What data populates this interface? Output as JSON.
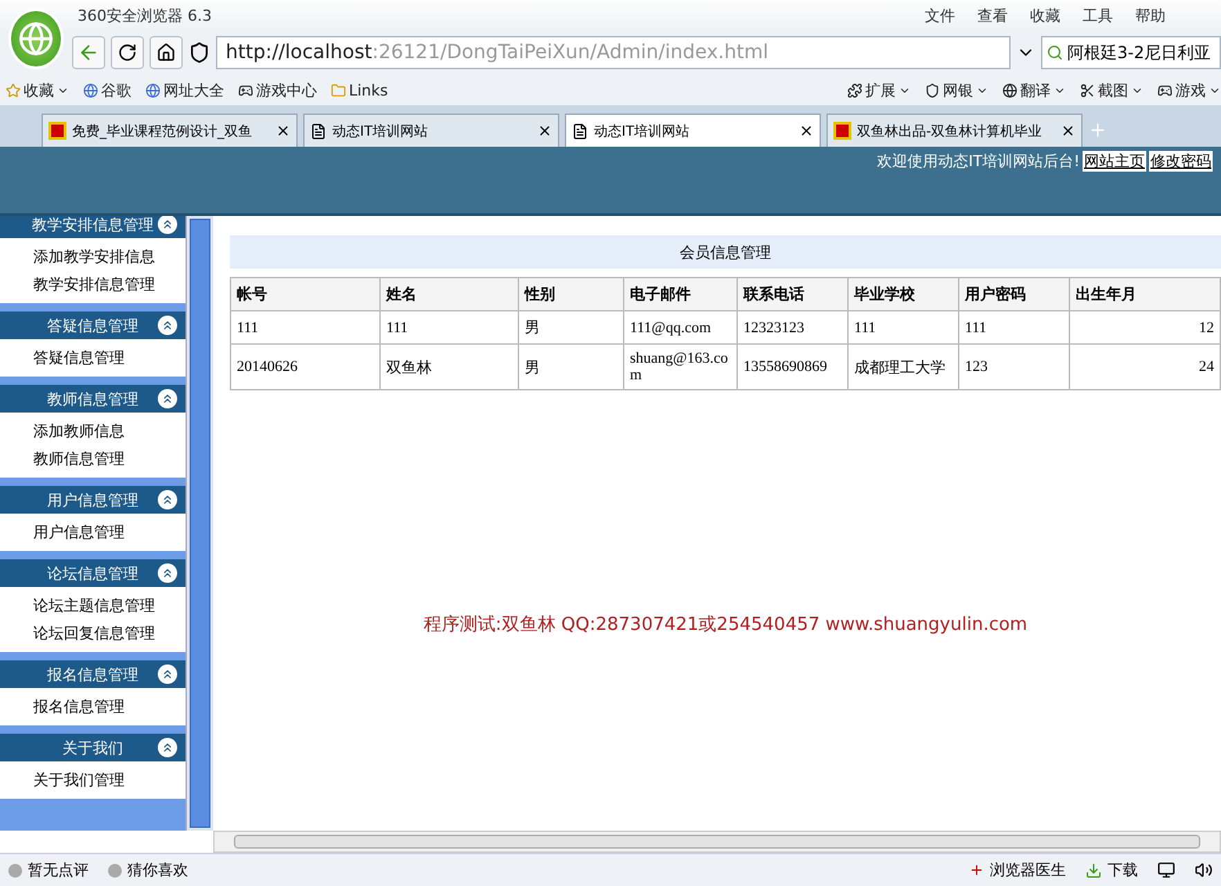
{
  "browser": {
    "title": "360安全浏览器 6.3",
    "menu": [
      "文件",
      "查看",
      "收藏",
      "工具",
      "帮助"
    ],
    "address": {
      "host": "http://localhost",
      "path": ":26121/DongTaiPeiXun/Admin/index.html"
    },
    "search": {
      "value": "阿根廷3-2尼日利亚"
    },
    "bookmarks": [
      {
        "label": "收藏",
        "dropdown": true
      },
      {
        "label": "谷歌",
        "dropdown": false
      },
      {
        "label": "网址大全",
        "dropdown": false
      },
      {
        "label": "游戏中心",
        "dropdown": false
      },
      {
        "label": "Links",
        "dropdown": false
      }
    ],
    "extensions": [
      {
        "label": "扩展"
      },
      {
        "label": "网银"
      },
      {
        "label": "翻译"
      },
      {
        "label": "截图"
      },
      {
        "label": "游戏"
      }
    ],
    "tabs": [
      {
        "label": "免费_毕业课程范例设计_双鱼",
        "selected": false,
        "kind": "site"
      },
      {
        "label": "动态IT培训网站",
        "selected": false,
        "kind": "page"
      },
      {
        "label": "动态IT培训网站",
        "selected": true,
        "kind": "page"
      },
      {
        "label": "双鱼林出品-双鱼林计算机毕业",
        "selected": false,
        "kind": "site"
      }
    ],
    "status": {
      "left": [
        "暂无点评",
        "猜你喜欢"
      ],
      "right": [
        "浏览器医生",
        "下载"
      ]
    }
  },
  "header": {
    "welcome": "欢迎使用动态IT培训网站后台!",
    "links": [
      "网站主页",
      "修改密码"
    ]
  },
  "sidebar": [
    {
      "title": "教学安排信息管理",
      "items": [
        "添加教学安排信息",
        "教学安排信息管理"
      ]
    },
    {
      "title": "答疑信息管理",
      "items": [
        "答疑信息管理"
      ]
    },
    {
      "title": "教师信息管理",
      "items": [
        "添加教师信息",
        "教师信息管理"
      ]
    },
    {
      "title": "用户信息管理",
      "items": [
        "用户信息管理"
      ]
    },
    {
      "title": "论坛信息管理",
      "items": [
        "论坛主题信息管理",
        "论坛回复信息管理"
      ]
    },
    {
      "title": "报名信息管理",
      "items": [
        "报名信息管理"
      ]
    },
    {
      "title": "关于我们",
      "items": [
        "关于我们管理"
      ]
    }
  ],
  "table": {
    "title": "会员信息管理",
    "columns": [
      "帐号",
      "姓名",
      "性别",
      "电子邮件",
      "联系电话",
      "毕业学校",
      "用户密码",
      "出生年月"
    ],
    "rows": [
      [
        "111",
        "111",
        "男",
        "111@qq.com",
        "12323123",
        "111",
        "111",
        "12"
      ],
      [
        "20140626",
        "双鱼林",
        "男",
        "shuang@163.com",
        "13558690869",
        "成都理工大学",
        "123",
        "24"
      ]
    ]
  },
  "note": "程序测试:双鱼林 QQ:287307421或254540457 www.shuangyulin.com"
}
